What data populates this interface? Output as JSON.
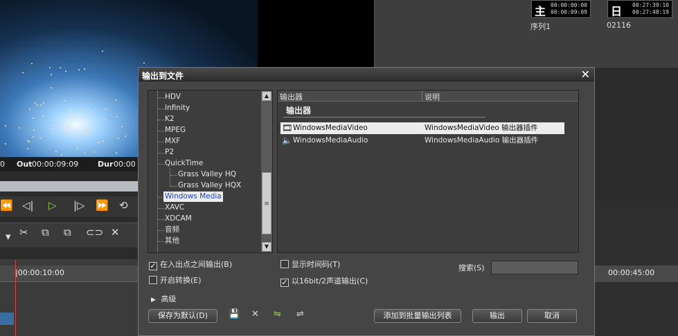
{
  "background": {
    "timecode_left": "0",
    "out_label": "Out",
    "out_value": "00:00:09:09",
    "dur_label": "Dur",
    "dur_value": "00:00",
    "ruler_left": "|00:00:10:00",
    "ruler_right": "00:00:45:00",
    "seq1": {
      "icon": "主",
      "tc1": "00:00:00:00",
      "tc2": "00:00:09:09",
      "label": "序列1"
    },
    "seq2": {
      "icon": "日",
      "tc1": "00:27:39:10",
      "tc2": "00:27:48:19",
      "label": "02116"
    }
  },
  "dialog": {
    "title": "输出到文件",
    "tree_items": [
      "HDV",
      "Infinity",
      "K2",
      "MPEG",
      "MXF",
      "P2",
      "QuickTime",
      "Grass Valley HQ",
      "Grass Valley HQX",
      "Windows Media",
      "XAVC",
      "XDCAM",
      "音频",
      "其他"
    ],
    "selected_tree_item": "Windows Media",
    "list_header": {
      "col1": "输出器",
      "col2": "说明"
    },
    "group_title": "输出器",
    "exporters": [
      {
        "icon": "film-icon",
        "name": "WindowsMediaVideo",
        "description": "WindowsMediaVideo 输出器插件"
      },
      {
        "icon": "speaker-icon",
        "name": "WindowsMediaAudio",
        "description": "WindowsMediaAudio 输出器插件"
      }
    ],
    "options": {
      "in_out": {
        "label": "在入出点之间输出(B)",
        "checked": true
      },
      "enable_convert": {
        "label": "开启转换(E)",
        "checked": false
      },
      "show_timecode": {
        "label": "显示时间码(T)",
        "checked": false
      },
      "bit16": {
        "label": "以16bit/2声道输出(C)",
        "checked": true
      }
    },
    "search_label": "搜索(S)",
    "search_value": "",
    "advanced_label": "高级",
    "buttons": {
      "save_default": "保存为默认(D)",
      "add_batch": "添加到批量输出列表",
      "export": "输出",
      "cancel": "取消"
    }
  }
}
